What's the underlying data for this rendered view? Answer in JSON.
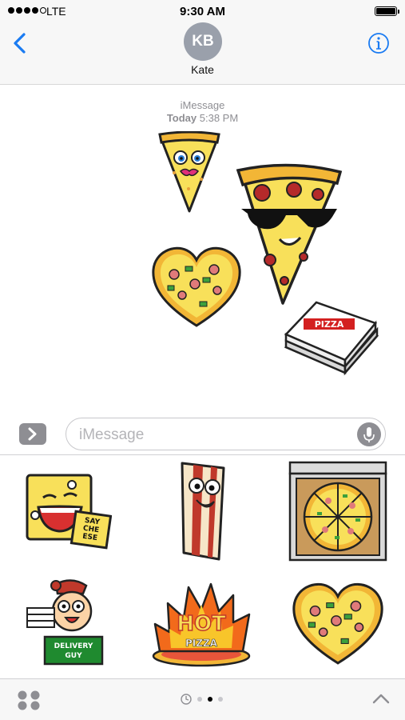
{
  "status_bar": {
    "carrier": "LTE",
    "time": "9:30 AM"
  },
  "header": {
    "back_icon": "chevron-left-icon",
    "avatar_initials": "KB",
    "contact_name": "Kate",
    "info_icon": "info-icon"
  },
  "conversation": {
    "service_label": "iMessage",
    "day": "Today",
    "time": "5:38 PM"
  },
  "sent_stickers": [
    {
      "name": "pizza-slice-lady"
    },
    {
      "name": "cool-pizza-slice"
    },
    {
      "name": "heart-pizza"
    },
    {
      "name": "pizza-box",
      "text": "PIZZA"
    }
  ],
  "composer": {
    "placeholder": "iMessage",
    "apps_icon": "chevron-right-icon",
    "mic_icon": "microphone-icon"
  },
  "sticker_drawer": [
    {
      "name": "say-cheese",
      "text": "SAY CHE ESE"
    },
    {
      "name": "bacon-strip"
    },
    {
      "name": "pizza-in-box"
    },
    {
      "name": "delivery-guy",
      "text": "DELIVERY GUY"
    },
    {
      "name": "hot-pizza",
      "text": "HOT",
      "text2": "PIZZA"
    },
    {
      "name": "heart-pizza"
    }
  ],
  "tab_bar": {
    "apps_icon": "app-grid-icon",
    "recents_icon": "clock-icon",
    "pages": 3,
    "active_page": 2,
    "expand_icon": "chevron-up-icon"
  },
  "colors": {
    "ios_blue": "#1a7bf2",
    "gray": "#8e8e93",
    "cheese": "#f8e05a",
    "crust": "#f2b636",
    "pepperoni": "#b52a2a"
  }
}
